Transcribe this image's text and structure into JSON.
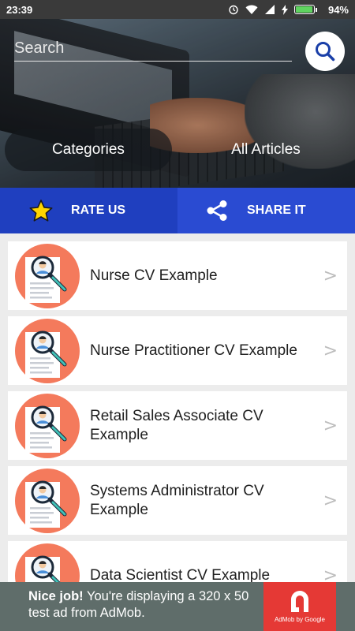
{
  "status_bar": {
    "time": "23:39",
    "battery": "94%",
    "battery_level": 0.94
  },
  "search": {
    "placeholder": "Search"
  },
  "tabs": {
    "categories": "Categories",
    "all_articles": "All Articles"
  },
  "actions": {
    "rate": "RATE US",
    "share": "SHARE IT"
  },
  "articles": [
    {
      "title": "Nurse CV Example"
    },
    {
      "title": "Nurse Practitioner CV Example"
    },
    {
      "title": "Retail Sales Associate CV Example"
    },
    {
      "title": "Systems Administrator CV Example"
    },
    {
      "title": "Data Scientist CV Example"
    }
  ],
  "ad": {
    "headline": "Nice job!",
    "body": " You're displaying a 320 x 50 test ad from AdMob.",
    "brand": "AdMob by Google"
  },
  "colors": {
    "rate_bg": "#1f3fbf",
    "share_bg": "#2a4bd2",
    "icon_circle": "#f47a5c",
    "ad_bg": "#5f6d6a",
    "ad_logo": "#e53935",
    "star": "#ffd600"
  },
  "icons": {
    "search": "search-icon",
    "star": "star-icon",
    "share": "share-icon",
    "article": "cv-magnifier-icon",
    "arrow": "chevron-right-icon"
  }
}
